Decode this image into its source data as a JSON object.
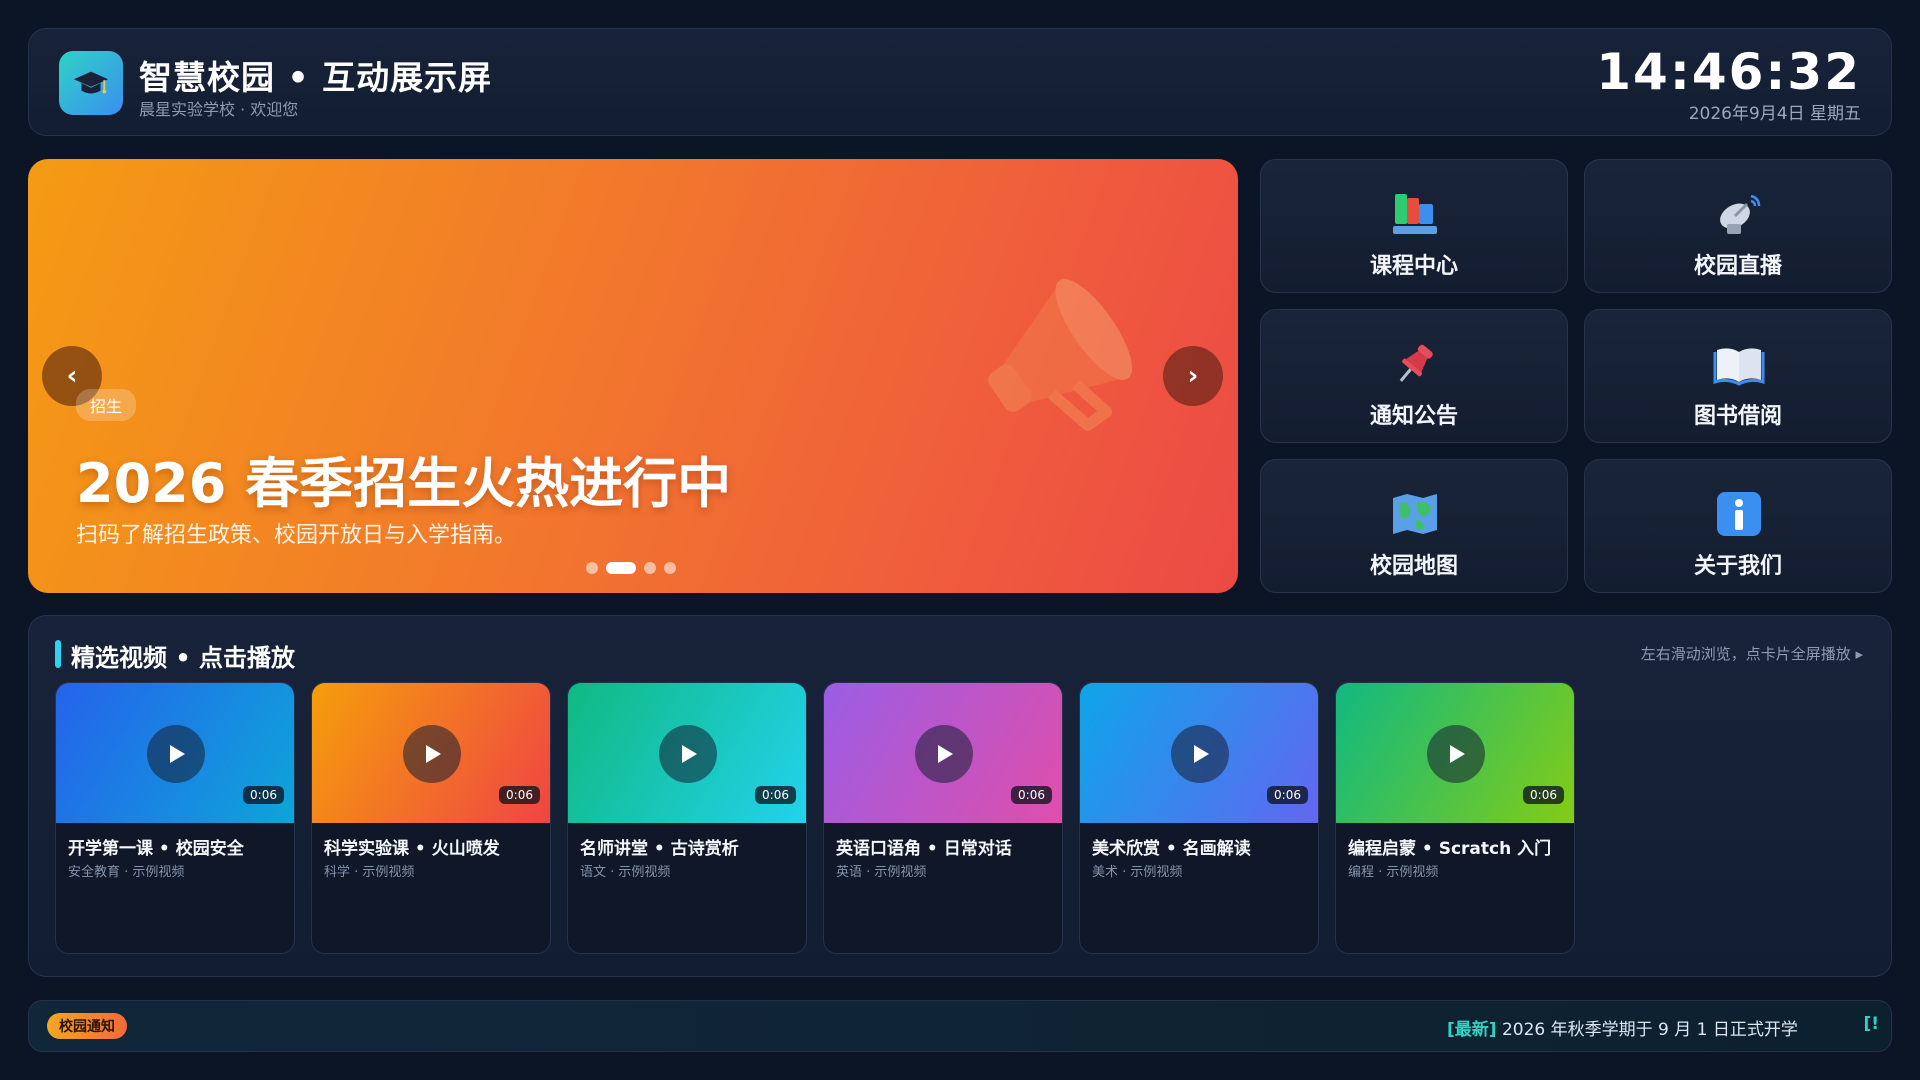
{
  "header": {
    "title": "智慧校园 • 互动展示屏",
    "subtitle": "晨星实验学校 · 欢迎您",
    "time": "14:46:32",
    "date": "2026年9月4日 星期五",
    "logo_icon": "graduation-cap-icon"
  },
  "banner": {
    "tag": "招生",
    "title": "2026 春季招生火热进行中",
    "description": "扫码了解招生政策、校园开放日与入学指南。",
    "prev_label": "‹",
    "next_label": "›",
    "slide_count": 4,
    "active_slide": 2,
    "colors": [
      "#f49b13",
      "#ec4a45"
    ]
  },
  "tiles": [
    {
      "label": "课程中心",
      "icon": "books-icon"
    },
    {
      "label": "校园直播",
      "icon": "satellite-dish-icon"
    },
    {
      "label": "通知公告",
      "icon": "pushpin-icon"
    },
    {
      "label": "图书借阅",
      "icon": "open-book-icon"
    },
    {
      "label": "校园地图",
      "icon": "map-icon"
    },
    {
      "label": "关于我们",
      "icon": "info-icon"
    }
  ],
  "videos": {
    "title": "精选视频 • 点击播放",
    "hint": "左右滑动浏览，点卡片全屏播放 ▸",
    "items": [
      {
        "title": "开学第一课 • 校园安全",
        "meta": "安全教育 · 示例视频",
        "duration": "0:06",
        "colors": [
          "#2563eb",
          "#0ea5d9"
        ]
      },
      {
        "title": "科学实验课 • 火山喷发",
        "meta": "科学 · 示例视频",
        "duration": "0:06",
        "colors": [
          "#f59e0b",
          "#ef4444"
        ]
      },
      {
        "title": "名师讲堂 • 古诗赏析",
        "meta": "语文 · 示例视频",
        "duration": "0:06",
        "colors": [
          "#10b981",
          "#22d3ee"
        ]
      },
      {
        "title": "英语口语角 • 日常对话",
        "meta": "英语 · 示例视频",
        "duration": "0:06",
        "colors": [
          "#9b5de5",
          "#e04eaa"
        ]
      },
      {
        "title": "美术欣赏 • 名画解读",
        "meta": "美术 · 示例视频",
        "duration": "0:06",
        "colors": [
          "#0ea5e9",
          "#6366f1"
        ]
      },
      {
        "title": "编程启蒙 • Scratch 入门",
        "meta": "编程 · 示例视频",
        "duration": "0:06",
        "colors": [
          "#10b981",
          "#84cc16"
        ]
      }
    ]
  },
  "ticker": {
    "label": "校园通知",
    "new_tag": "[最新]",
    "text": " 2026 年秋季学期于 9 月 1 日正式开学",
    "trailing": "[!"
  }
}
